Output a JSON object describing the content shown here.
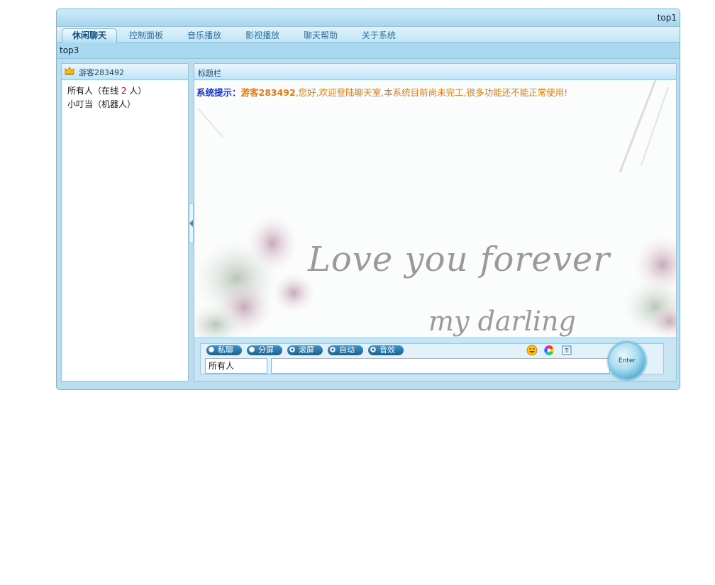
{
  "header": {
    "label": "top1"
  },
  "tabs": [
    {
      "label": "休闲聊天",
      "active": true
    },
    {
      "label": "控制面板"
    },
    {
      "label": "音乐播放"
    },
    {
      "label": "影视播放"
    },
    {
      "label": "聊天帮助"
    },
    {
      "label": "关于系统"
    }
  ],
  "subbar": {
    "label": "top3"
  },
  "user_panel": {
    "username": "游客283492",
    "all_prefix": "所有人（在线 ",
    "online_count": "2",
    "all_suffix": " 人）",
    "bot": "小叮当（机器人）"
  },
  "chat_panel": {
    "title": "标题栏",
    "message": {
      "prefix": "系统提示：",
      "user": "游客283492",
      "text": ",您好,欢迎登陆聊天室,本系统目前尚未完工,很多功能还不能正常使用!"
    },
    "background_line1": "Love you forever",
    "background_line2": "my darling"
  },
  "controls": {
    "options": [
      {
        "label": "私聊",
        "checked": false
      },
      {
        "label": "分屏",
        "checked": false
      },
      {
        "label": "滚屏",
        "checked": true
      },
      {
        "label": "自动",
        "checked": true
      },
      {
        "label": "音效",
        "checked": true
      }
    ],
    "target": "所有人",
    "input_value": "",
    "enter_label": "Enter"
  },
  "icons": [
    "crown-icon",
    "smiley-icon",
    "color-wheel-icon",
    "font-icon"
  ],
  "colors": {
    "accent": "#1c5f91",
    "system": "#1a33cc",
    "notice": "#e07b14"
  }
}
